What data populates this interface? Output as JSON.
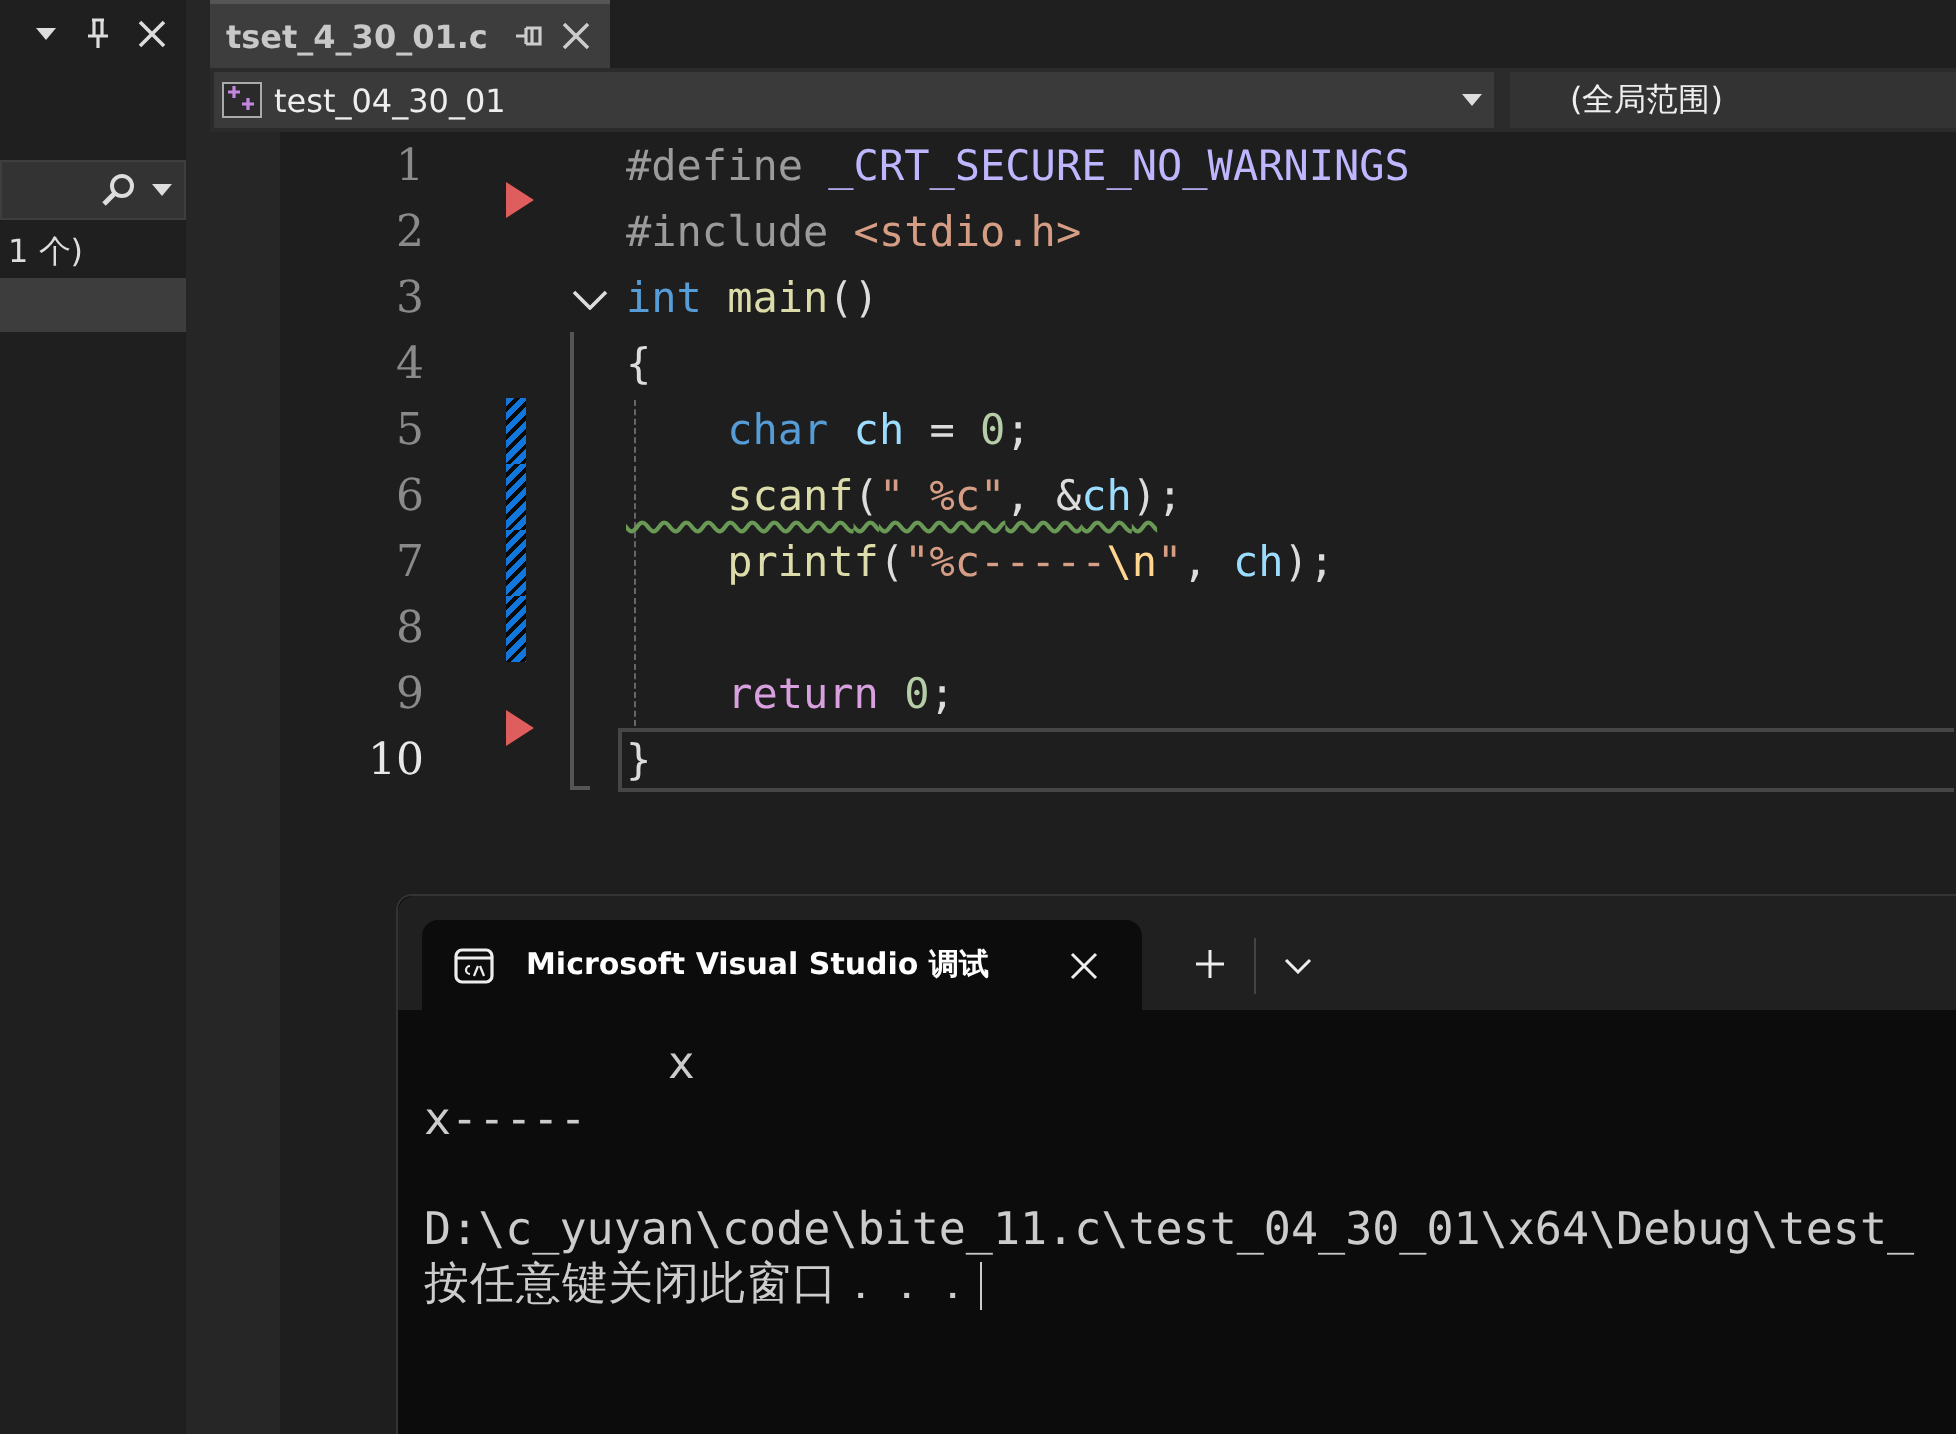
{
  "side_panel": {
    "status_text": "1 个)"
  },
  "editor_tab": {
    "title": "tset_4_30_01.c",
    "selected": true
  },
  "nav_bar": {
    "project": "test_04_30_01",
    "scope": "(全局范围)"
  },
  "code_lines": [
    {
      "number": "1",
      "current": false,
      "changed": false,
      "marker": false,
      "fold": false,
      "tokens": [
        {
          "kind": "preproc",
          "text": "#define "
        },
        {
          "kind": "macro",
          "text": "_CRT_SECURE_NO_WARNINGS"
        }
      ]
    },
    {
      "number": "2",
      "current": false,
      "changed": false,
      "marker": true,
      "fold": false,
      "tokens": [
        {
          "kind": "preproc",
          "text": "#include "
        },
        {
          "kind": "string",
          "text": "<stdio.h>"
        }
      ]
    },
    {
      "number": "3",
      "current": false,
      "changed": false,
      "marker": false,
      "fold": true,
      "tokens": [
        {
          "kind": "keyword",
          "text": "int "
        },
        {
          "kind": "function",
          "text": "main"
        },
        {
          "kind": "plain",
          "text": "()"
        }
      ]
    },
    {
      "number": "4",
      "current": false,
      "changed": false,
      "marker": false,
      "fold": false,
      "tokens": [
        {
          "kind": "plain",
          "text": "{"
        }
      ]
    },
    {
      "number": "5",
      "current": false,
      "changed": true,
      "marker": false,
      "fold": false,
      "tokens": [
        {
          "kind": "keyword",
          "text": "    char "
        },
        {
          "kind": "variable",
          "text": "ch "
        },
        {
          "kind": "plain",
          "text": "= "
        },
        {
          "kind": "number",
          "text": "0"
        },
        {
          "kind": "plain",
          "text": ";"
        }
      ]
    },
    {
      "number": "6",
      "current": false,
      "changed": true,
      "marker": false,
      "fold": false,
      "tokens": [
        {
          "kind": "function",
          "text": "    scanf",
          "squiggle": true
        },
        {
          "kind": "plain",
          "text": "(",
          "squiggle": true
        },
        {
          "kind": "string",
          "text": "\" %c\"",
          "squiggle": true
        },
        {
          "kind": "plain",
          "text": ", &",
          "squiggle": true
        },
        {
          "kind": "variable",
          "text": "ch",
          "squiggle": true
        },
        {
          "kind": "plain",
          "text": ")",
          "squiggle": true
        },
        {
          "kind": "plain",
          "text": ";"
        }
      ]
    },
    {
      "number": "7",
      "current": false,
      "changed": true,
      "marker": false,
      "fold": false,
      "tokens": [
        {
          "kind": "function",
          "text": "    printf"
        },
        {
          "kind": "plain",
          "text": "("
        },
        {
          "kind": "string",
          "text": "\"%c-----"
        },
        {
          "kind": "escape",
          "text": "\\n"
        },
        {
          "kind": "string",
          "text": "\""
        },
        {
          "kind": "plain",
          "text": ", "
        },
        {
          "kind": "variable",
          "text": "ch"
        },
        {
          "kind": "plain",
          "text": ");"
        }
      ]
    },
    {
      "number": "8",
      "current": false,
      "changed": true,
      "marker": false,
      "fold": false
    },
    {
      "number": "9",
      "current": false,
      "changed": false,
      "marker": false,
      "fold": false,
      "tokens": [
        {
          "kind": "control",
          "text": "    return "
        },
        {
          "kind": "number",
          "text": "0"
        },
        {
          "kind": "plain",
          "text": ";"
        }
      ]
    },
    {
      "number": "10",
      "current": true,
      "changed": false,
      "marker": true,
      "fold": false,
      "tokens": [
        {
          "kind": "plain",
          "text": "}"
        }
      ]
    }
  ],
  "console": {
    "tab_title": "Microsoft Visual Studio 调试",
    "output_lines": [
      "         x",
      "x-----",
      "D:\\c_yuyan\\code\\bite_11.c\\test_04_30_01\\x64\\Debug\\test_",
      "按任意键关闭此窗口．．．"
    ]
  }
}
